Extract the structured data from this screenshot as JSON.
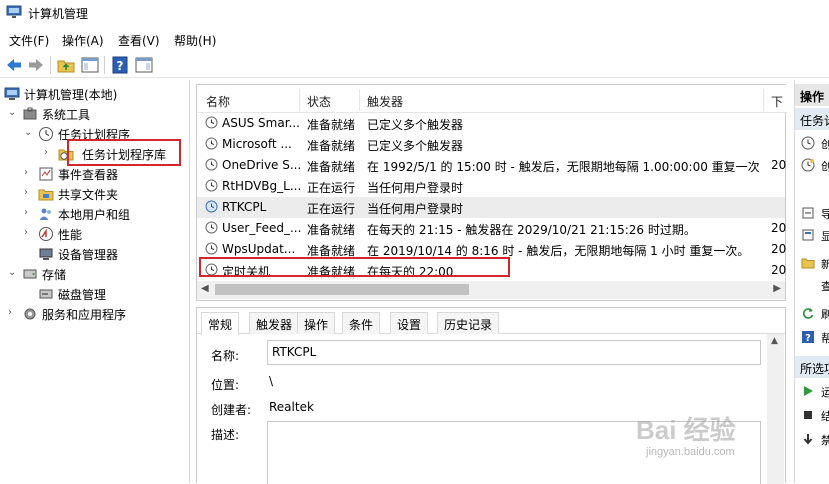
{
  "window": {
    "title": "计算机管理"
  },
  "menu": [
    "文件(F)",
    "操作(A)",
    "查看(V)",
    "帮助(H)"
  ],
  "tree": {
    "root": "计算机管理(本地)",
    "system_tools": "系统工具",
    "task_scheduler": "任务计划程序",
    "task_library": "任务计划程序库",
    "event_viewer": "事件查看器",
    "shared_folders": "共享文件夹",
    "local_users": "本地用户和组",
    "performance": "性能",
    "device_manager": "设备管理器",
    "storage": "存储",
    "disk_mgmt": "磁盘管理",
    "services": "服务和应用程序"
  },
  "list": {
    "headers": {
      "name": "名称",
      "status": "状态",
      "trigger": "触发器",
      "next": "下"
    },
    "rows": [
      {
        "name": "ASUS Smar...",
        "status": "准备就绪",
        "trigger": "已定义多个触发器",
        "extra": ""
      },
      {
        "name": "Microsoft ...",
        "status": "准备就绪",
        "trigger": "已定义多个触发器",
        "extra": ""
      },
      {
        "name": "OneDrive S...",
        "status": "准备就绪",
        "trigger": "在 1992/5/1 的 15:00 时 - 触发后，无限期地每隔 1.00:00:00 重复一次。",
        "extra": "20"
      },
      {
        "name": "RtHDVBg_L...",
        "status": "正在运行",
        "trigger": "当任何用户登录时",
        "extra": ""
      },
      {
        "name": "RTKCPL",
        "status": "正在运行",
        "trigger": "当任何用户登录时",
        "extra": ""
      },
      {
        "name": "User_Feed_...",
        "status": "准备就绪",
        "trigger": "在每天的 21:15 - 触发器在 2029/10/21 21:15:26 时过期。",
        "extra": "20"
      },
      {
        "name": "WpsUpdat...",
        "status": "准备就绪",
        "trigger": "在 2019/10/14 的 8:16 时 - 触发后，无限期地每隔 1 小时 重复一次。",
        "extra": "20"
      },
      {
        "name": "定时关机",
        "status": "准备就绪",
        "trigger": "在每天的 22:00",
        "extra": "20"
      }
    ]
  },
  "detail": {
    "tabs": [
      "常规",
      "触发器",
      "操作",
      "条件",
      "设置",
      "历史记录"
    ],
    "name_label": "名称:",
    "name_value": "RTKCPL",
    "location_label": "位置:",
    "location_value": "\\",
    "author_label": "创建者:",
    "author_value": "Realtek",
    "desc_label": "描述:"
  },
  "actions": {
    "header": "操作",
    "sub1": "任务计",
    "sub2": "所选项",
    "items_a": [
      "创",
      "创",
      "导",
      "显",
      "禁",
      "新",
      "查",
      "刷",
      "帮"
    ],
    "items_b": [
      "运",
      "结",
      "禁"
    ]
  },
  "watermark": {
    "main": "Bai 经验",
    "sub": "jingyan.baidu.com"
  },
  "colors": {
    "highlight": "#d4252b",
    "selected_row": "#ececec"
  }
}
